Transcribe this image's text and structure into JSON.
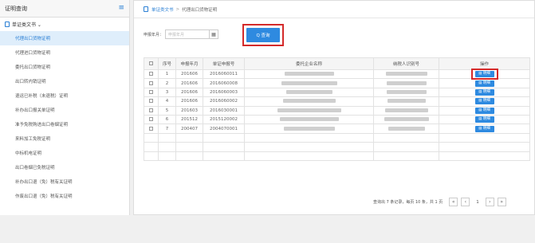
{
  "sidebar": {
    "title": "证明查询",
    "group_label": "单证类文书 ⌄",
    "items": [
      {
        "label": "代理出口货物证明",
        "active": true
      },
      {
        "label": "代理进口货物证明",
        "active": false
      },
      {
        "label": "委托出口货物证明",
        "active": false
      },
      {
        "label": "出口转内销证明",
        "active": false
      },
      {
        "label": "退运已补税（未退税）证明",
        "active": false
      },
      {
        "label": "补办出口报关单证明",
        "active": false
      },
      {
        "label": "准予免税购进出口卷烟证明",
        "active": false
      },
      {
        "label": "来料加工免税证明",
        "active": false
      },
      {
        "label": "中标机电证明",
        "active": false
      },
      {
        "label": "出口卷烟已免税证明",
        "active": false
      },
      {
        "label": "补办出口退（免）税有关证明",
        "active": false
      },
      {
        "label": "作废出口退（免）税有关证明",
        "active": false
      }
    ]
  },
  "breadcrumb": {
    "first": "单证类文书",
    "separator": ">",
    "current": "代理出口货物证明"
  },
  "filter": {
    "label": "申报年月：",
    "placeholder": "申报年月",
    "search_label": "Q 查询"
  },
  "table": {
    "headers": [
      "",
      "序号",
      "申报年月",
      "单证申报号",
      "委托企业名称",
      "纳税人识别号",
      "操作"
    ],
    "detail_label": "▤ 明细",
    "rows": [
      {
        "no": "1",
        "period": "201606",
        "doc_no": "2016060011"
      },
      {
        "no": "2",
        "period": "201606",
        "doc_no": "2016060008"
      },
      {
        "no": "3",
        "period": "201606",
        "doc_no": "2016060003"
      },
      {
        "no": "4",
        "period": "201606",
        "doc_no": "2016060002"
      },
      {
        "no": "5",
        "period": "201603",
        "doc_no": "2016030001"
      },
      {
        "no": "6",
        "period": "201512",
        "doc_no": "2015120002"
      },
      {
        "no": "7",
        "period": "200407",
        "doc_no": "2004070001"
      }
    ]
  },
  "pager": {
    "summary": "查询出 7 条记录，每页 10 条，共 1 页",
    "first": "«",
    "prev": "‹",
    "page": "1",
    "next": "›",
    "last": "»"
  },
  "colors": {
    "accent": "#2e8ae0",
    "highlight_outline": "#d42a2a",
    "active_bg": "#dfeefb"
  }
}
